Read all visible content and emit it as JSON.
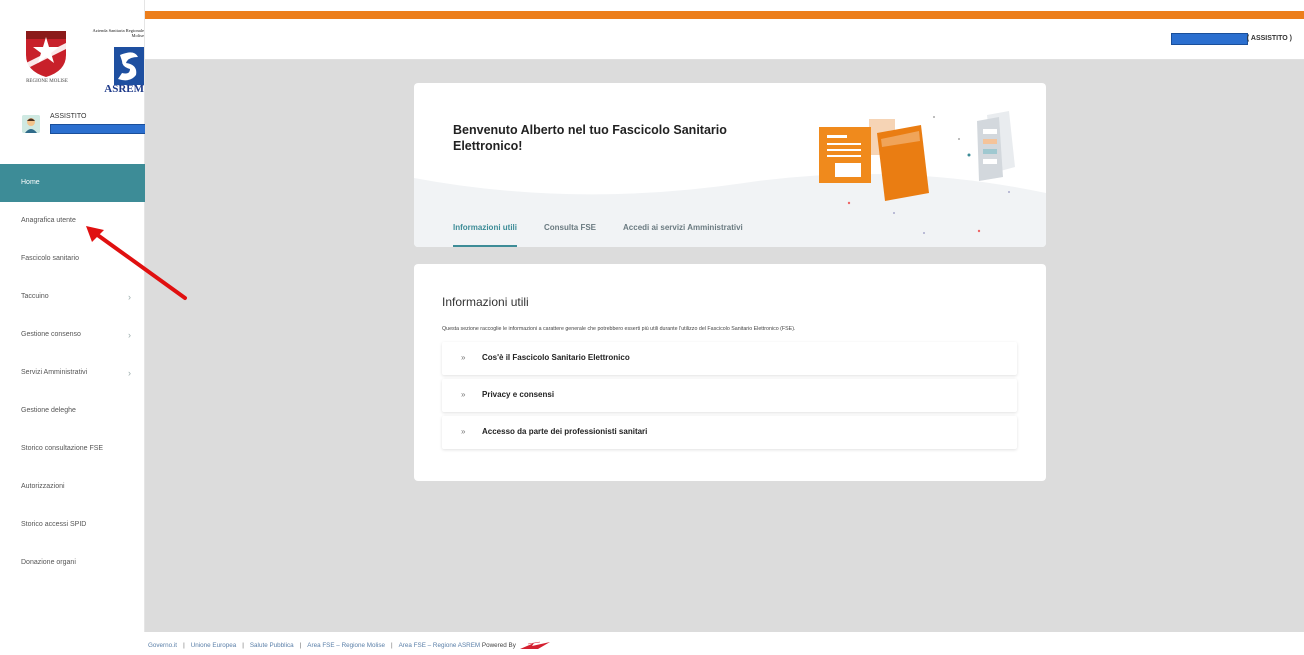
{
  "logos": {
    "crest_caption": "REGIONE MOLISE",
    "asrem_small": "Azienda Sanitaria Regionale Molise",
    "asrem_text": "ASREM"
  },
  "user": {
    "role": "ASSISTITO"
  },
  "header": {
    "role": "( ASSISTITO )"
  },
  "nav": {
    "items": [
      {
        "label": "Home",
        "active": true
      },
      {
        "label": "Anagrafica utente"
      },
      {
        "label": "Fascicolo sanitario"
      },
      {
        "label": "Taccuino",
        "chevron": "›"
      },
      {
        "label": "Gestione consenso",
        "chevron": "›"
      },
      {
        "label": "Servizi Amministrativi",
        "chevron": "›"
      },
      {
        "label": "Gestione deleghe"
      },
      {
        "label": "Storico consultazione FSE"
      },
      {
        "label": "Autorizzazioni"
      },
      {
        "label": "Storico accessi SPID"
      },
      {
        "label": "Donazione organi"
      }
    ]
  },
  "welcome": {
    "title": "Benvenuto Alberto nel tuo Fascicolo Sanitario Elettronico!",
    "tabs": [
      "Informazioni utili",
      "Consulta FSE",
      "Accedi ai servizi Amministrativi"
    ]
  },
  "info": {
    "title": "Informazioni utili",
    "description": "Questa sezione raccoglie le informazioni a carattere generale che potrebbero esserti più utili durante l'utilizzo del Fascicolo Sanitario Elettronico (FSE).",
    "items": [
      "Cos'è il Fascicolo Sanitario Elettronico",
      "Privacy e consensi",
      "Accesso da parte dei professionisti sanitari"
    ],
    "chevron": "»"
  },
  "footer": {
    "links": [
      "Governo.it",
      "Unione Europea",
      "Salute Pubblica",
      "Area FSE – Regione Molise",
      "Area FSE – Regione ASREM"
    ],
    "separator": "|",
    "powered_by": "Powered By"
  },
  "colors": {
    "accent": "#3d8c97",
    "orange": "#ec7e1b",
    "redaction": "#2b6fcf",
    "annotation": "#e01010"
  }
}
